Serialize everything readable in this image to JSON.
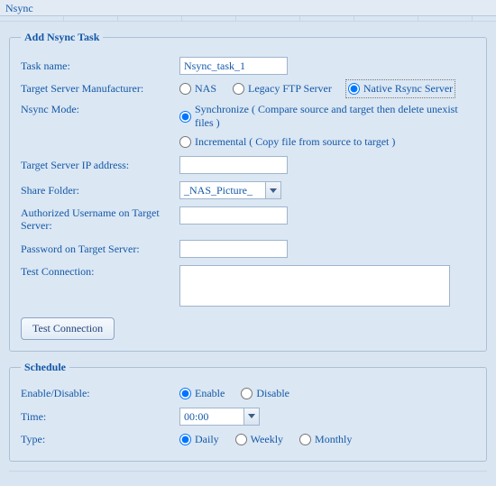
{
  "window": {
    "title": "Nsync"
  },
  "panel_task": {
    "legend": "Add Nsync Task",
    "task_name_label": "Task name:",
    "task_name_value": "Nsync_task_1",
    "manufacturer_label": "Target Server Manufacturer:",
    "manufacturer_options": {
      "nas": "NAS",
      "legacy": "Legacy FTP Server",
      "native": "Native Rsync Server",
      "selected": "native"
    },
    "mode_label": "Nsync Mode:",
    "mode_options": {
      "sync": "Synchronize ( Compare source and target then delete unexist files )",
      "incr": "Incremental ( Copy file from source to target )",
      "selected": "sync"
    },
    "ip_label": "Target Server IP address:",
    "ip_value": "",
    "share_label": "Share Folder:",
    "share_value": "_NAS_Picture_",
    "username_label": "Authorized Username on Target Server:",
    "username_value": "",
    "password_label": "Password on Target Server:",
    "password_value": "",
    "testconn_label": "Test Connection:",
    "testconn_value": "",
    "testconn_button": "Test Connection"
  },
  "panel_schedule": {
    "legend": "Schedule",
    "enable_label": "Enable/Disable:",
    "enable_options": {
      "enable": "Enable",
      "disable": "Disable",
      "selected": "enable"
    },
    "time_label": "Time:",
    "time_value": "00:00",
    "type_label": "Type:",
    "type_options": {
      "daily": "Daily",
      "weekly": "Weekly",
      "monthly": "Monthly",
      "selected": "daily"
    }
  }
}
